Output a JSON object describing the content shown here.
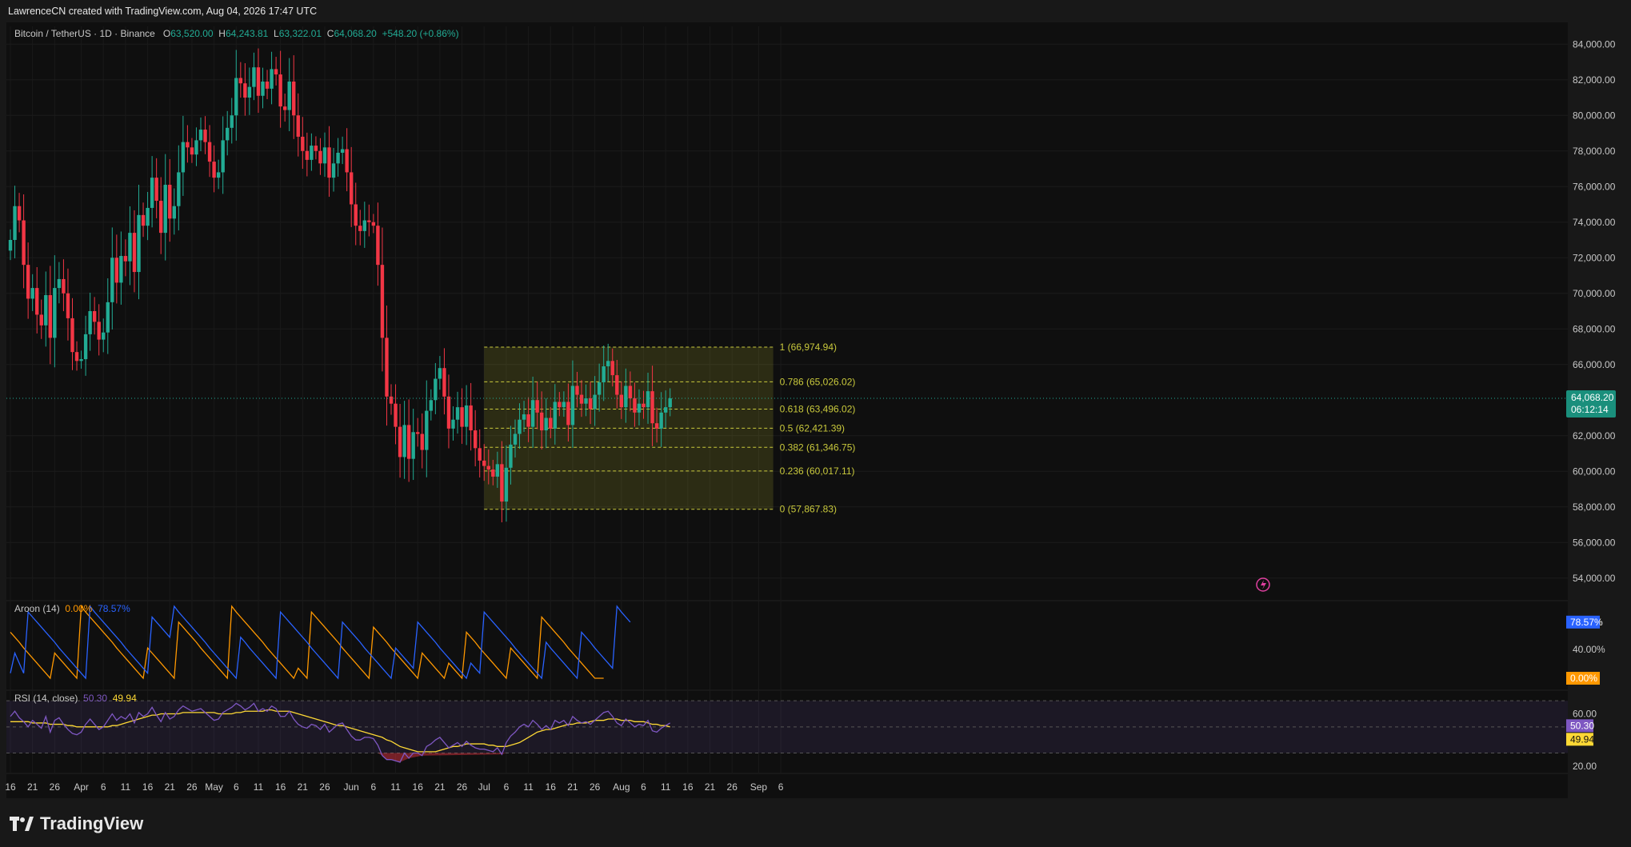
{
  "header": {
    "attribution": "LawrenceCN created with TradingView.com, Aug 04, 2026 17:47 UTC"
  },
  "symbol": {
    "title": "Bitcoin / TetherUS · 1D · Binance",
    "open_label": "O",
    "open": "63,520.00",
    "high_label": "H",
    "high": "64,243.81",
    "low_label": "L",
    "low": "63,322.01",
    "close_label": "C",
    "close": "64,068.20",
    "change": "+548.20 (+0.86%)",
    "price_tag": "64,068.20",
    "countdown": "06:12:14"
  },
  "aroon": {
    "label": "Aroon (14)",
    "down_value": "0.00%",
    "up_value": "78.57%",
    "axis_tick": "40.00%",
    "tag_up": "78.57%",
    "tag_down": "0.00%"
  },
  "rsi": {
    "label": "RSI (14, close)",
    "rsi_value": "50.30",
    "ma_value": "49.94",
    "ticks": [
      "60.00",
      "20.00"
    ],
    "tag_rsi": "50.30",
    "tag_ma": "49.94"
  },
  "colors": {
    "up": "#22ab94",
    "down": "#f23645",
    "aroon_up": "#2962ff",
    "aroon_down": "#ff9800",
    "rsi": "#7e57c2",
    "rsi_ma": "#fdd835",
    "fib": "#c9c93c"
  },
  "branding": {
    "name": "TradingView"
  },
  "chart_data": {
    "type": "candlestick",
    "price_axis": {
      "min": 53000,
      "max": 85000,
      "ticks": [
        "84,000.00",
        "82,000.00",
        "80,000.00",
        "78,000.00",
        "76,000.00",
        "74,000.00",
        "72,000.00",
        "70,000.00",
        "68,000.00",
        "66,000.00",
        "62,000.00",
        "60,000.00",
        "58,000.00",
        "56,000.00",
        "54,000.00"
      ],
      "tick_values": [
        84000,
        82000,
        80000,
        78000,
        76000,
        74000,
        72000,
        70000,
        68000,
        66000,
        62000,
        60000,
        58000,
        56000,
        54000
      ]
    },
    "time_axis": {
      "labels": [
        "16",
        "21",
        "26",
        "Apr",
        "6",
        "11",
        "16",
        "21",
        "26",
        "May",
        "6",
        "11",
        "16",
        "21",
        "26",
        "Jun",
        "6",
        "11",
        "16",
        "21",
        "26",
        "Jul",
        "6",
        "11",
        "16",
        "21",
        "26",
        "Aug",
        "6",
        "11",
        "16",
        "21",
        "26",
        "Sep",
        "6"
      ],
      "label_index": [
        0,
        5,
        10,
        16,
        21,
        26,
        31,
        36,
        41,
        46,
        51,
        56,
        61,
        66,
        71,
        77,
        82,
        87,
        92,
        97,
        102,
        107,
        112,
        117,
        122,
        127,
        132,
        138,
        143,
        148,
        153,
        158,
        163,
        169,
        174
      ]
    },
    "fibonacci": {
      "levels": [
        {
          "ratio": "1",
          "price": 66974.94,
          "label": "1 (66,974.94)"
        },
        {
          "ratio": "0.786",
          "price": 65026.02,
          "label": "0.786 (65,026.02)"
        },
        {
          "ratio": "0.618",
          "price": 63496.02,
          "label": "0.618 (63,496.02)"
        },
        {
          "ratio": "0.5",
          "price": 62421.39,
          "label": "0.5 (62,421.39)"
        },
        {
          "ratio": "0.382",
          "price": 61346.75,
          "label": "0.382 (61,346.75)"
        },
        {
          "ratio": "0.236",
          "price": 60017.11,
          "label": "0.236 (60,017.11)"
        },
        {
          "ratio": "0",
          "price": 57867.83,
          "label": "0 (57,867.83)"
        }
      ],
      "start_index": 107,
      "end_index": 147
    },
    "closes": [
      73000,
      74900,
      74100,
      71600,
      69700,
      70300,
      68800,
      68200,
      69900,
      67500,
      70300,
      70800,
      70000,
      68600,
      66700,
      66200,
      66300,
      67700,
      69000,
      68400,
      67400,
      67800,
      69500,
      72000,
      70600,
      72100,
      71800,
      73400,
      71200,
      74400,
      73800,
      74800,
      76500,
      75200,
      73400,
      76100,
      74200,
      74900,
      76800,
      78500,
      78200,
      77800,
      78600,
      79200,
      78500,
      77400,
      76500,
      76800,
      78600,
      79300,
      80000,
      82100,
      81800,
      81000,
      81600,
      82700,
      81100,
      81900,
      81500,
      82600,
      82300,
      80500,
      80300,
      81900,
      80000,
      78800,
      78000,
      77500,
      78300,
      78000,
      77300,
      78200,
      76500,
      77300,
      77900,
      78100,
      76800,
      75000,
      73800,
      73500,
      74100,
      74000,
      73800,
      71600,
      67500,
      64200,
      63800,
      62500,
      60800,
      62600,
      60700,
      62200,
      62100,
      61200,
      63400,
      64000,
      65200,
      65800,
      64200,
      62400,
      62900,
      63600,
      62500,
      63700,
      62300,
      61300,
      60600,
      60300,
      60100,
      59700,
      60400,
      58300,
      60200,
      61500,
      62100,
      62900,
      63200,
      62500,
      64000,
      63300,
      62300,
      63000,
      62400,
      63900,
      63600,
      63900,
      62600,
      64800,
      64300,
      63800,
      64100,
      63500,
      64300,
      65000,
      65900,
      66200,
      65400,
      64300,
      63600,
      64800,
      64100,
      63300,
      63800,
      63600,
      64500,
      62700,
      62400,
      63300,
      63600,
      64100
    ],
    "aroon_up": [
      7,
      35,
      21,
      7,
      92,
      85,
      78,
      71,
      64,
      57,
      50,
      42,
      35,
      28,
      21,
      14,
      7,
      0,
      100,
      92,
      85,
      78,
      71,
      64,
      57,
      50,
      42,
      35,
      28,
      21,
      14,
      7,
      85,
      78,
      71,
      64,
      57,
      100,
      92,
      85,
      78,
      71,
      64,
      57,
      50,
      42,
      35,
      28,
      21,
      14,
      7,
      0,
      57,
      50,
      42,
      35,
      28,
      21,
      14,
      7,
      0,
      92,
      85,
      78,
      71,
      64,
      57,
      50,
      42,
      35,
      28,
      21,
      14,
      7,
      0,
      78,
      71,
      64,
      57,
      50,
      42,
      35,
      28,
      21,
      14,
      7,
      0,
      42,
      35,
      28,
      21,
      14,
      78,
      71,
      64,
      57,
      50,
      42,
      35,
      28,
      21,
      14,
      7,
      0,
      21,
      14,
      7,
      92,
      85,
      78,
      71,
      64,
      57,
      50,
      42,
      35,
      28,
      21,
      14,
      7,
      0,
      50,
      42,
      35,
      28,
      21,
      14,
      7,
      0,
      64,
      57,
      50,
      42,
      35,
      28,
      21,
      14,
      100,
      92,
      85,
      78
    ],
    "aroon_down": [
      64,
      57,
      50,
      42,
      35,
      28,
      21,
      14,
      7,
      0,
      35,
      28,
      21,
      14,
      7,
      0,
      100,
      92,
      85,
      78,
      71,
      64,
      57,
      50,
      42,
      35,
      28,
      21,
      14,
      7,
      0,
      42,
      35,
      28,
      21,
      14,
      7,
      0,
      78,
      71,
      64,
      57,
      50,
      42,
      35,
      28,
      21,
      14,
      7,
      0,
      100,
      92,
      85,
      78,
      71,
      64,
      57,
      50,
      42,
      35,
      28,
      21,
      14,
      7,
      0,
      14,
      7,
      0,
      92,
      85,
      78,
      71,
      64,
      57,
      50,
      42,
      35,
      28,
      21,
      14,
      7,
      0,
      71,
      64,
      57,
      50,
      42,
      35,
      28,
      21,
      14,
      7,
      0,
      35,
      28,
      21,
      14,
      7,
      0,
      21,
      14,
      7,
      0,
      64,
      57,
      50,
      42,
      35,
      28,
      21,
      14,
      7,
      0,
      42,
      35,
      28,
      21,
      14,
      7,
      0,
      85,
      78,
      71,
      64,
      57,
      50,
      42,
      35,
      28,
      21,
      14,
      7,
      0,
      0,
      0
    ],
    "rsi": [
      58,
      62,
      57,
      54,
      50,
      55,
      52,
      49,
      58,
      46,
      55,
      57,
      52,
      48,
      45,
      44,
      46,
      52,
      56,
      52,
      48,
      50,
      55,
      60,
      55,
      58,
      56,
      60,
      53,
      61,
      58,
      60,
      65,
      59,
      54,
      61,
      56,
      58,
      63,
      66,
      64,
      62,
      63,
      64,
      61,
      58,
      55,
      56,
      61,
      63,
      65,
      68,
      66,
      63,
      65,
      68,
      62,
      64,
      62,
      66,
      64,
      58,
      58,
      62,
      56,
      52,
      50,
      49,
      52,
      51,
      48,
      52,
      46,
      49,
      52,
      53,
      48,
      43,
      40,
      40,
      42,
      42,
      41,
      36,
      28,
      25,
      25,
      24,
      23,
      30,
      26,
      30,
      30,
      28,
      35,
      37,
      40,
      42,
      38,
      34,
      36,
      38,
      35,
      39,
      36,
      34,
      33,
      33,
      32,
      31,
      34,
      29,
      38,
      43,
      46,
      50,
      52,
      50,
      55,
      52,
      48,
      51,
      48,
      55,
      53,
      55,
      51,
      58,
      55,
      53,
      54,
      52,
      55,
      58,
      61,
      62,
      58,
      53,
      51,
      56,
      53,
      50,
      52,
      51,
      55,
      47,
      46,
      49,
      51,
      53
    ],
    "rsi_ma": [
      54,
      54,
      54,
      54,
      54,
      53,
      53,
      53,
      53,
      52,
      52,
      52,
      52,
      51,
      51,
      50,
      50,
      50,
      50,
      50,
      50,
      50,
      50,
      51,
      51,
      52,
      53,
      54,
      55,
      56,
      57,
      58,
      59,
      59,
      60,
      60,
      60,
      60,
      60,
      61,
      61,
      61,
      61,
      61,
      61,
      61,
      61,
      60,
      60,
      60,
      60,
      61,
      61,
      62,
      62,
      62,
      62,
      62,
      63,
      63,
      62,
      62,
      62,
      62,
      61,
      60,
      59,
      58,
      57,
      56,
      55,
      54,
      53,
      52,
      51,
      51,
      50,
      49,
      48,
      47,
      46,
      45,
      44,
      43,
      42,
      40,
      39,
      37,
      35,
      34,
      33,
      32,
      31,
      31,
      31,
      31,
      31,
      32,
      33,
      34,
      35,
      35,
      36,
      37,
      37,
      37,
      37,
      37,
      36,
      36,
      35,
      35,
      35,
      36,
      37,
      38,
      40,
      42,
      44,
      46,
      47,
      48,
      48,
      49,
      50,
      51,
      52,
      52,
      53,
      53,
      53,
      54,
      55,
      55,
      55,
      56,
      56,
      56,
      55,
      55,
      55,
      54,
      54,
      54,
      53,
      52,
      52,
      51,
      51,
      50
    ]
  }
}
